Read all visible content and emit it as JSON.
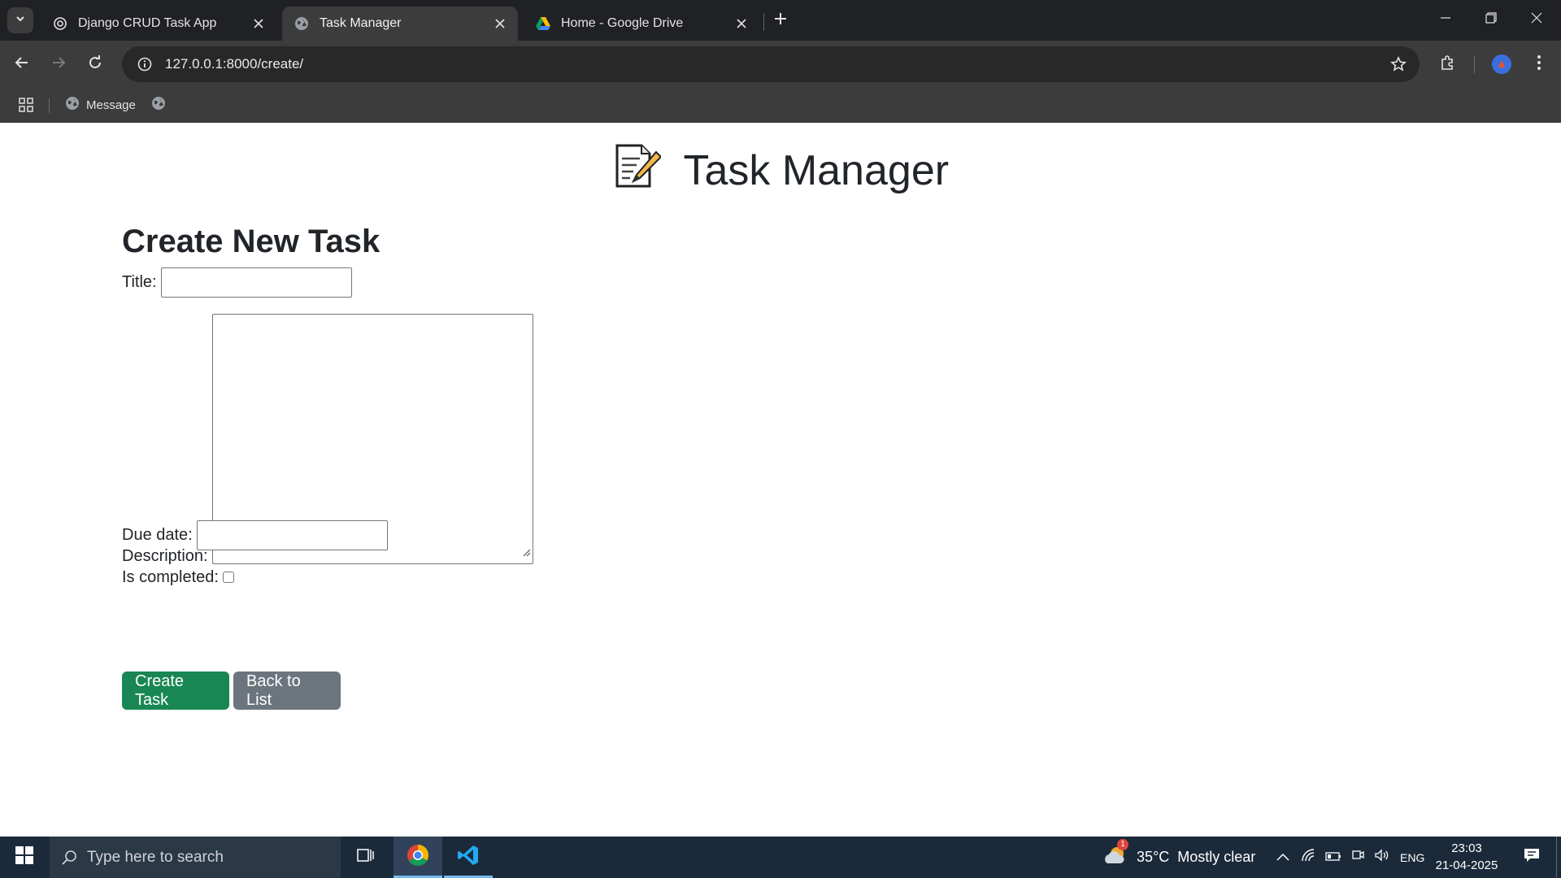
{
  "browser": {
    "tabs": [
      {
        "label": "Django CRUD Task App",
        "active": false,
        "icon": "openai-icon"
      },
      {
        "label": "Task Manager",
        "active": true,
        "icon": "globe-icon"
      },
      {
        "label": "Home - Google Drive",
        "active": false,
        "icon": "google-drive-icon"
      }
    ],
    "url": "127.0.0.1:8000/create/",
    "bookmarks": [
      {
        "label": "Message",
        "icon": "globe-icon"
      },
      {
        "label": "",
        "icon": "globe-icon"
      }
    ]
  },
  "page": {
    "title_emoji": "📝",
    "title": "Task Manager",
    "form_heading": "Create New Task",
    "fields": {
      "title_label": "Title:",
      "title_value": "",
      "description_label": "Description:",
      "description_value": "",
      "due_date_label": "Due date:",
      "due_date_value": "",
      "is_completed_label": "Is completed:",
      "is_completed_checked": false
    },
    "buttons": {
      "create": "Create Task",
      "back": "Back to List"
    },
    "colors": {
      "create_button": "#198754",
      "back_button": "#6c757d"
    }
  },
  "taskbar": {
    "search_placeholder": "Type here to search",
    "weather": "35°C  Mostly clear",
    "weather_badge": "1",
    "language": "ENG",
    "time": "23:03",
    "date": "21-04-2025"
  }
}
